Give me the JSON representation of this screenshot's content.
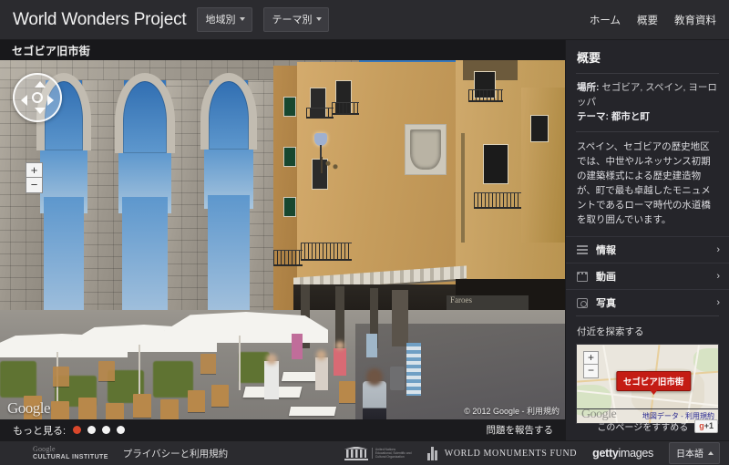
{
  "header": {
    "brand": "World Wonders Project",
    "dropdowns": [
      {
        "label": "地域別",
        "icon": "chevron-down-icon"
      },
      {
        "label": "テーマ別",
        "icon": "chevron-down-icon"
      }
    ],
    "nav": [
      {
        "label": "ホーム"
      },
      {
        "label": "概要"
      },
      {
        "label": "教育資料"
      }
    ]
  },
  "viewer": {
    "title": "セゴビア旧市街",
    "pano_watermark": "Google",
    "pano_copyright_prefix": "© 2012 Google - ",
    "pano_copyright_link": "利用規約",
    "controls": {
      "pan": "pan-control-icon",
      "zoom_in": "+",
      "zoom_out": "−"
    },
    "more_label": "もっと見る:",
    "thumbnail_count": 4,
    "active_thumbnail": 1,
    "report_link": "問題を報告する"
  },
  "sidebar": {
    "title": "概要",
    "meta": [
      {
        "key": "場所:",
        "value": " セゴビア, スペイン, ヨーロッパ"
      },
      {
        "key": "テーマ:",
        "value": " 都市と町"
      }
    ],
    "description": "スペイン、セゴビアの歴史地区では、中世やルネッサンス初期の建築様式による歴史建造物が、町で最も卓越したモニュメントであるローマ時代の水道橋を取り囲んでいます。",
    "accordion": [
      {
        "label": "情報",
        "icon": "list-icon",
        "chevron": "›"
      },
      {
        "label": "動画",
        "icon": "film-icon",
        "chevron": "›"
      },
      {
        "label": "写真",
        "icon": "camera-icon",
        "chevron": "›"
      }
    ],
    "map": {
      "heading": "付近を探索する",
      "marker_label": "セゴビア旧市街",
      "zoom_in": "+",
      "zoom_out": "−",
      "watermark": "Google",
      "data_link": "地図データ",
      "terms_link": "利用規約",
      "link_separator": " - "
    },
    "recommend": {
      "label": "このページをすすめる",
      "button_prefix": "g",
      "button_suffix": "+1"
    }
  },
  "footer": {
    "logo_line1": "Google",
    "logo_line2": "CULTURAL INSTITUTE",
    "privacy_link": "プライバシーと利用規約",
    "partners": [
      {
        "name": "unesco-logo",
        "caption": "United Nations Educational, Scientific and Cultural Organization"
      },
      {
        "name": "world-monuments-fund-logo",
        "caption": "WORLD MONUMENTS FUND"
      },
      {
        "name": "getty-images-logo",
        "caption_bold": "getty",
        "caption_light": "images"
      }
    ],
    "language": {
      "label": "日本語",
      "icon": "chevron-up-icon"
    }
  },
  "colors": {
    "accent_red": "#c41c14",
    "active_dot": "#d9472b",
    "topbar_bg": "#2b2b2f",
    "sidebar_bg": "#25252a",
    "page_bg": "#1b1b1e"
  }
}
